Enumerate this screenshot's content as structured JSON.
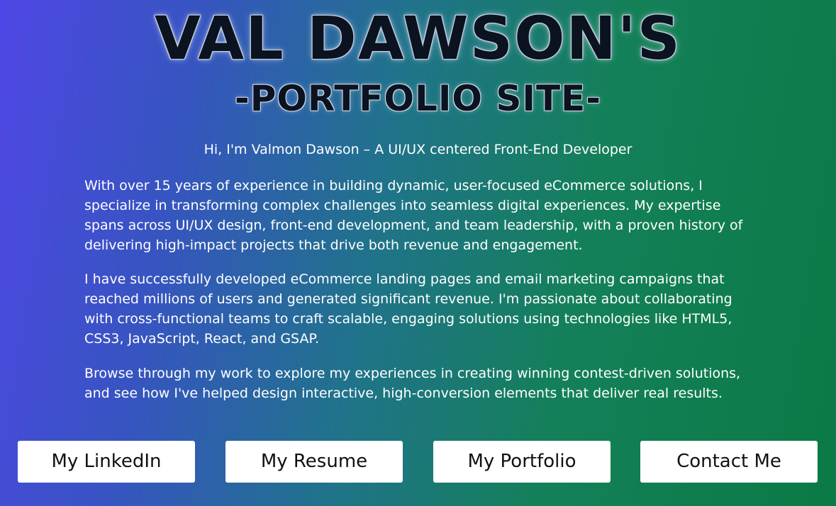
{
  "header": {
    "title": "VAL DAWSON'S",
    "subtitle": "-PORTFOLIO SITE-"
  },
  "intro": "Hi, I'm Valmon Dawson – A UI/UX centered Front-End Developer",
  "bio": [
    "With over 15 years of experience in building dynamic, user-focused eCommerce solutions, I specialize in transforming complex challenges into seamless digital experiences. My expertise spans across UI/UX design, front-end development, and team leadership, with a proven history of delivering high-impact projects that drive both revenue and engagement.",
    "I have successfully developed eCommerce landing pages and email marketing campaigns that reached millions of users and generated significant revenue. I'm passionate about collaborating with cross-functional teams to craft scalable, engaging solutions using technologies like HTML5, CSS3, JavaScript, React, and GSAP.",
    "Browse through my work to explore my experiences in creating winning contest-driven solutions, and see how I've helped design interactive, high-conversion elements that deliver real results."
  ],
  "buttons": {
    "linkedin": "My LinkedIn",
    "resume": "My Resume",
    "portfolio": "My Portfolio",
    "contact": "Contact Me"
  },
  "colors": {
    "gradient_start": "#4f46e5",
    "gradient_end": "#0b7a45",
    "button_bg": "#ffffff",
    "button_text": "#111111"
  }
}
